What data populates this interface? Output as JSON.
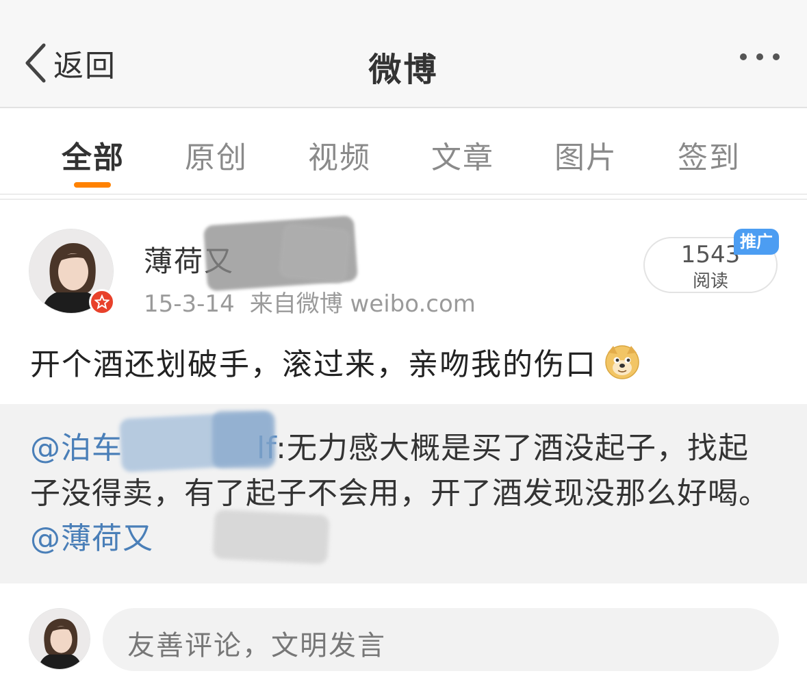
{
  "nav": {
    "back_label": "返回",
    "title": "微博",
    "more_icon": "more-dots-icon"
  },
  "tabs": [
    {
      "label": "全部",
      "active": true
    },
    {
      "label": "原创",
      "active": false
    },
    {
      "label": "视频",
      "active": false
    },
    {
      "label": "文章",
      "active": false
    },
    {
      "label": "图片",
      "active": false
    },
    {
      "label": "签到",
      "active": false
    }
  ],
  "colors": {
    "accent": "#ff8200",
    "mention": "#4a7fb8",
    "promo_badge": "#4c9df2",
    "vip_badge": "#e8412b"
  },
  "post": {
    "username": "薄荷又",
    "date": "15-3-14",
    "source": "来自微博 weibo.com",
    "read_count": "1543",
    "read_label": "阅读",
    "promo_badge": "推广",
    "text": "开个酒还划破手，滚过来，亲吻我的伤口",
    "emoji": "doge-icon"
  },
  "repost": {
    "mention_author": "@泊车",
    "author_tail": "lf",
    "body": ":无力感大概是买了酒没起子，找起子没得卖，有了起子不会用，开了酒发现没那么好喝。",
    "mention_tag": "@薄荷又"
  },
  "comment": {
    "placeholder": "友善评论，文明发言"
  }
}
